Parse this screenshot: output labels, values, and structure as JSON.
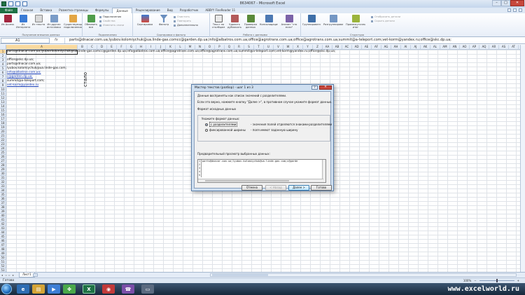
{
  "window": {
    "title": "8634067 - Microsoft Excel"
  },
  "ribbon": {
    "file_tab": "Файл",
    "tabs": [
      "Главная",
      "Вставка",
      "Разметка страницы",
      "Формулы",
      "Данные",
      "Рецензирование",
      "Вид",
      "Разработчик",
      "ABBYY FineReader 11"
    ],
    "active_tab_index": 4,
    "groups": {
      "external": {
        "label": "Получение внешних данных",
        "buttons": [
          "Из Access",
          "Из Интернета",
          "Из текста",
          "Из других источников",
          "Существующие подключения"
        ]
      },
      "connections": {
        "label": "Подключения",
        "refresh_label": "Обновить все",
        "items": [
          "Подключения",
          "Свойства",
          "Изменить связи"
        ]
      },
      "sort": {
        "label": "Сортировка и фильтр",
        "sort_label": "Сортировка",
        "filter_label": "Фильтр",
        "items": [
          "Очистить",
          "Повторить",
          "Дополнительно"
        ]
      },
      "data_tools": {
        "label": "Работа с данными",
        "buttons": [
          "Текст по столбцам",
          "Удалить дубликаты",
          "Проверка данных",
          "Консолидация",
          "Анализ \"что если\""
        ]
      },
      "outline": {
        "label": "Структура",
        "buttons": [
          "Группировать",
          "Разгруппировать",
          "Промежуточный итог"
        ],
        "items": [
          "Отобразить детали",
          "Скрыть детали"
        ]
      }
    }
  },
  "formula_bar": {
    "cell_ref": "A1",
    "fx_label": "fx",
    "content": "parts@dnacar.com.ua;lyubov.kolomiychuk@ua.linde-gas.comcc@garden.dp.ua;info@albatros.com.ua;office@agrotrans.com.ua;office@agrotrans.com.ua;summit@a-teleport.com;vet-korm@yandex.ru;office@skc.dp.ua;"
  },
  "grid": {
    "columns": [
      "A",
      "B",
      "C",
      "D",
      "E",
      "F",
      "G",
      "H",
      "I",
      "J",
      "K",
      "L",
      "M",
      "N",
      "O",
      "P",
      "Q",
      "R",
      "S",
      "T",
      "U",
      "V",
      "W",
      "X",
      "Y",
      "Z",
      "AA",
      "AB",
      "AC",
      "AD",
      "AE",
      "AF",
      "AG",
      "AH",
      "AI",
      "AJ",
      "AK",
      "AL",
      "AM",
      "AN",
      "AO",
      "AP",
      "AQ",
      "AR",
      "AS",
      "AT",
      "AU"
    ],
    "row_numbers": [
      "1",
      "2",
      "3",
      "4",
      "5",
      "6",
      "7",
      "8",
      "9",
      "10",
      "11",
      "12",
      "13",
      "14",
      "15",
      "16",
      "17",
      "18",
      "19",
      "20",
      "21",
      "22",
      "23",
      "24",
      "25",
      "26",
      "27",
      "28",
      "29",
      "30",
      "31",
      "32",
      "33",
      "34",
      "35",
      "36",
      "37",
      "38",
      "39",
      "40",
      "41",
      "42",
      "43",
      "44",
      "45",
      "46",
      "47",
      "48",
      "49",
      "50",
      "51",
      "52",
      "53"
    ],
    "row1": "parts@dnacar.com.ua;lyubov.kolomiychuk@ua.linde-gas.comcc@garden.dp.ua;info@albatros.com.ua;office@agrotrans.com.ua;office@agrotrans.com.ua;summit@a-teleport.com;vet-korm@yandex.ru;office@skc.dp.ua;",
    "cells": [
      {
        "row": 3,
        "text": "office@skc.dp.ua;",
        "link": false
      },
      {
        "row": 4,
        "text": "parts@dnacar.com.ua;",
        "link": false
      },
      {
        "row": 5,
        "text": "lyubov.kolomiychuk@ua.linde-gas.com;",
        "link": false
      },
      {
        "row": 6,
        "text": "info@albatros.com.ua;",
        "link": true
      },
      {
        "row": 7,
        "text": "c@garden.dp.ua;",
        "link": true
      },
      {
        "row": 8,
        "text": "summit@a-teleport.com;",
        "link": false
      },
      {
        "row": 9,
        "text": "vet-korm@yandex.ru",
        "link": true
      }
    ],
    "side_label": "стало"
  },
  "sheets": {
    "nav": "◂ ◃ ▹ ▸",
    "tabs": [
      "Лист1"
    ]
  },
  "status": {
    "mode": "Готово",
    "zoom": "100%"
  },
  "dialog": {
    "title": "Мастер текстов (разбор) - шаг 1 из 3",
    "help_icon": "?",
    "close_icon": "✕",
    "line1": "Данные восприняты как список значений с разделителями.",
    "line2": "Если это верно, нажмите кнопку \"Далее >\", в противном случае укажите формат данных.",
    "format_group": "Формат исходных данных",
    "format_prompt": "Укажите формат данных:",
    "option_delimited": "с разделителями",
    "option_delimited_desc": "- значения полей отделяются знаками-разделителями",
    "option_fixed": "фиксированной ширины",
    "option_fixed_desc": "- поля имеют заданную ширину",
    "preview_label": "Предварительный просмотр выбранных данных:",
    "preview_rows": [
      {
        "num": "1",
        "text": "parts@dnacar.com.ua;lyubov.kolomiychuk@ua.linde-gas.com;c@garde"
      },
      {
        "num": "2",
        "text": ""
      },
      {
        "num": "3",
        "text": ""
      },
      {
        "num": "4",
        "text": ""
      },
      {
        "num": "5",
        "text": ""
      }
    ],
    "buttons": {
      "cancel": "Отмена",
      "back": "< Назад",
      "next": "Далее >",
      "finish": "Готово"
    }
  },
  "taskbar": {
    "watermark": "www.excelworld.ru"
  }
}
